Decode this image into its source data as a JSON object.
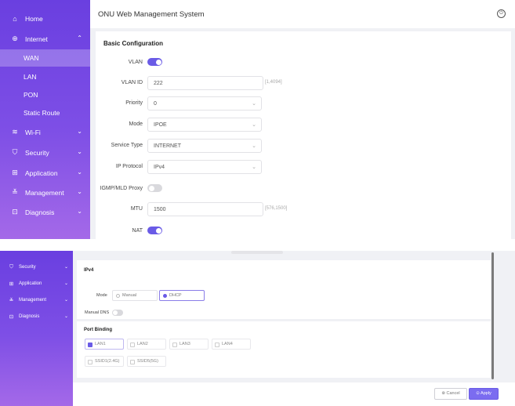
{
  "app": {
    "title": "ONU Web Management System"
  },
  "sidebar": {
    "home": "Home",
    "internet": "Internet",
    "internet_sub": [
      "WAN",
      "LAN",
      "PON",
      "Static Route"
    ],
    "wifi": "Wi-Fi",
    "security": "Security",
    "application": "Application",
    "management": "Management",
    "diagnosis": "Diagnosis"
  },
  "basic": {
    "title": "Basic Configuration",
    "vlan": {
      "label": "VLAN",
      "on": true
    },
    "vlan_id": {
      "label": "VLAN ID",
      "value": "222",
      "hint": "[1,4094]"
    },
    "priority": {
      "label": "Priority",
      "value": "0"
    },
    "mode": {
      "label": "Mode",
      "value": "IPOE"
    },
    "service_type": {
      "label": "Service Type",
      "value": "INTERNET"
    },
    "ip_protocol": {
      "label": "IP Protocol",
      "value": "IPv4"
    },
    "igmp": {
      "label": "IGMP/MLD Proxy",
      "on": false
    },
    "mtu": {
      "label": "MTU",
      "value": "1500",
      "hint": "[576,1500]"
    },
    "nat": {
      "label": "NAT",
      "on": true
    }
  },
  "ipv4": {
    "title": "IPv4",
    "mode_label": "Mode",
    "options": [
      "Manual",
      "DHCP"
    ],
    "selected": "DHCP",
    "manual_dns_label": "Manual DNS"
  },
  "port_binding": {
    "title": "Port Binding",
    "ports": [
      "LAN1",
      "LAN2",
      "LAN3",
      "LAN4"
    ],
    "ssids": [
      "SSID1(2.4G)",
      "SSID5(5G)"
    ],
    "checked": [
      "LAN1"
    ]
  },
  "footer": {
    "cancel": "Cancel",
    "apply": "Apply"
  },
  "colors": {
    "accent": "#6a5be6",
    "sidebar_top": "#6a3fe0",
    "sidebar_bottom": "#a469e8"
  }
}
